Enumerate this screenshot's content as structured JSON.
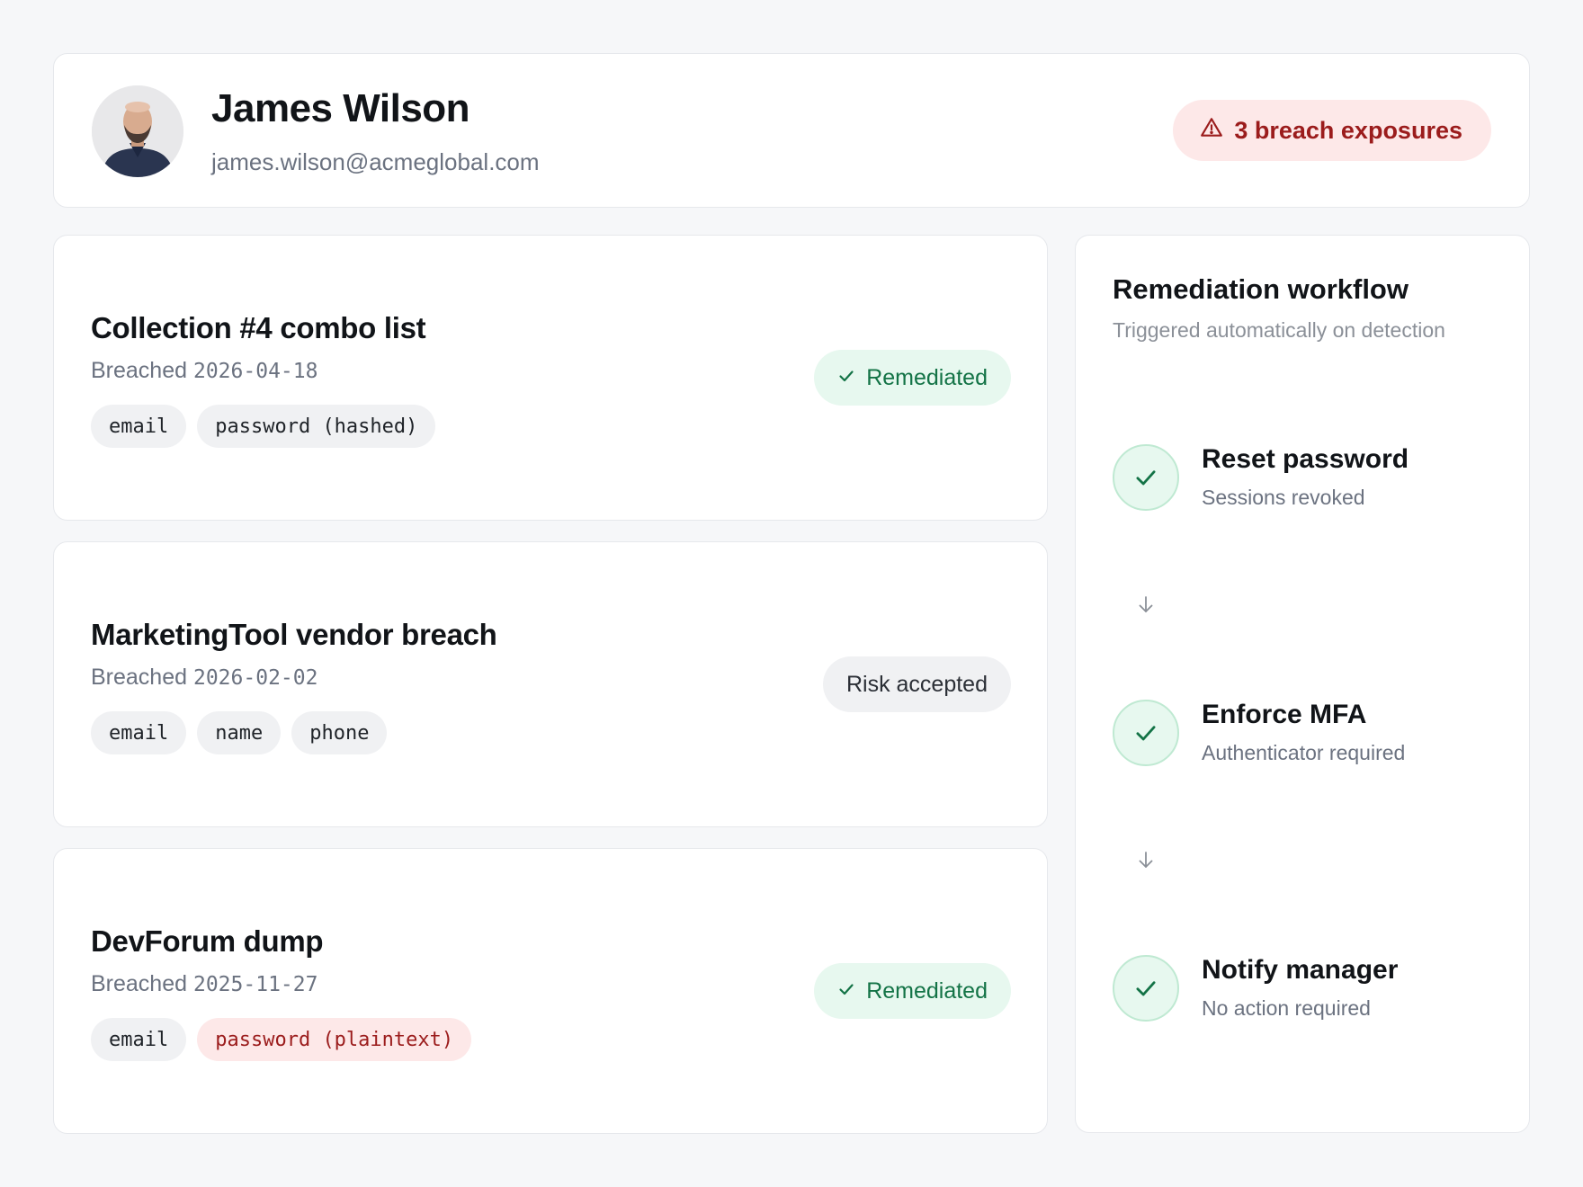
{
  "profile": {
    "name": "James Wilson",
    "email": "james.wilson@acmeglobal.com",
    "avatar_icon": "user-avatar-photo",
    "exposure_badge": "3 breach exposures",
    "exposure_icon": "warning-triangle-icon"
  },
  "breaches": [
    {
      "title": "Collection #4 combo list",
      "date_prefix": "Breached",
      "date": "2026-04-18",
      "tags": [
        {
          "label": "email"
        },
        {
          "label": "password (hashed)"
        }
      ],
      "status": "Remediated",
      "status_icon": "check-icon"
    },
    {
      "title": "MarketingTool vendor breach",
      "date_prefix": "Breached",
      "date": "2026-02-02",
      "tags": [
        {
          "label": "email"
        },
        {
          "label": "name"
        },
        {
          "label": "phone"
        }
      ],
      "status": "Risk accepted"
    },
    {
      "title": "DevForum dump",
      "date_prefix": "Breached",
      "date": "2025-11-27",
      "tags": [
        {
          "label": "email"
        },
        {
          "label": "password (plaintext)",
          "severity": "danger"
        }
      ],
      "status": "Remediated",
      "status_icon": "check-icon"
    }
  ],
  "workflow": {
    "title": "Remediation workflow",
    "subtitle": "Triggered automatically on detection",
    "steps": [
      {
        "label": "Reset password",
        "detail": "Sessions revoked",
        "icon": "check-icon"
      },
      {
        "label": "Enforce MFA",
        "detail": "Authenticator required",
        "icon": "check-icon"
      },
      {
        "label": "Notify manager",
        "detail": "No action required",
        "icon": "check-icon"
      }
    ],
    "connector_icon": "arrow-down-icon"
  },
  "colors": {
    "danger": "#9b1c1c",
    "danger_bg": "#fde8e8",
    "success": "#137346",
    "success_bg": "#e7f8ef",
    "neutral_bg": "#f0f1f3"
  }
}
